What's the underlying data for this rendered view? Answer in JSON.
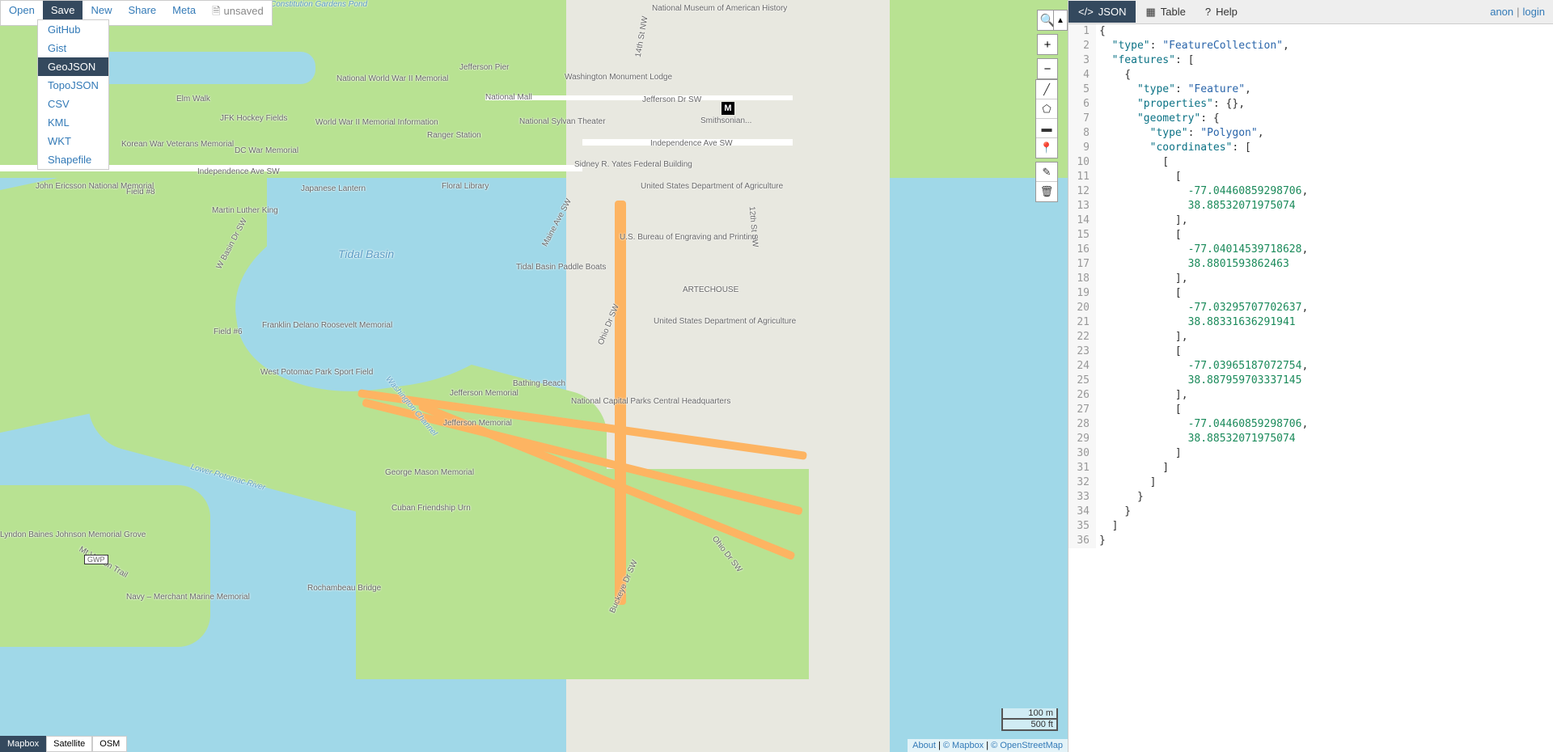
{
  "menu": {
    "open": "Open",
    "save": "Save",
    "new": "New",
    "share": "Share",
    "meta": "Meta",
    "status": "unsaved"
  },
  "dropdown": {
    "github": "GitHub",
    "gist": "Gist",
    "geojson": "GeoJSON",
    "topojson": "TopoJSON",
    "csv": "CSV",
    "kml": "KML",
    "wkt": "WKT",
    "shapefile": "Shapefile"
  },
  "tabs": {
    "json": "JSON",
    "table": "Table",
    "help": "Help"
  },
  "auth": {
    "anon": "anon",
    "login": "login"
  },
  "layers": {
    "mapbox": "Mapbox",
    "satellite": "Satellite",
    "osm": "OSM"
  },
  "scale": {
    "metric": "100 m",
    "imperial": "500 ft"
  },
  "attribution": {
    "about": "About",
    "mapbox": "© Mapbox",
    "osm": "© OpenStreetMap"
  },
  "zoom": {
    "plus": "+",
    "minus": "−",
    "search": "🔍"
  },
  "map_labels": {
    "nmah": "National Museum of\nAmerican History",
    "const_pond": "Constitution\nGardens Pond",
    "jefferson_pier": "Jefferson Pier",
    "washington_mon": "Washington\nMonument Lodge",
    "nww2": "National World\nWar II Memorial",
    "ww2info": "World War II Memorial\nInformation",
    "national_mall": "National Mall",
    "jeff_dr": "Jefferson Dr SW",
    "nat_sylvan": "National Sylvan\nTheater",
    "smithsonian": "Smithsonian...",
    "elm_walk": "Elm Walk",
    "jfk": "JFK Hockey Fields",
    "ranger": "Ranger Station",
    "ind_ave": "Independence Ave SW",
    "ind_ave2": "Independence Ave SW",
    "japanese": "Japanese Lantern",
    "floral": "Floral Library",
    "yates": "Sidney R. Yates\nFederal Building",
    "usda1": "United States Department\nof Agriculture",
    "usda2": "United States Department\nof Agriculture",
    "artechouse": "ARTECHOUSE",
    "bep": "U.S. Bureau of Engraving\nand Printing",
    "mlk": "Martin Luther King",
    "korean": "Korean War\nVeterans Memorial",
    "dcwar": "DC War Memorial",
    "field8": "Field #8",
    "field6": "Field #6",
    "ericsson": "John Ericsson\nNational Memorial",
    "tidal_basin": "Tidal Basin",
    "tidal_paddle": "Tidal Basin\nPaddle Boats",
    "fdr": "Franklin Delano\nRoosevelt Memorial",
    "west_potomac": "West Potomac\nPark Sport Field",
    "jeff_mem": "Jefferson Memorial",
    "jeff_mem2": "Jefferson Memorial",
    "bathing": "Bathing Beach",
    "ncp": "National Capital Parks\nCentral Headquarters",
    "wash_channel": "Washington Channel",
    "lower_potomac": "Lower Potomac River",
    "george_mason": "George Mason\nMemorial",
    "cuban": "Cuban Friendship Urn",
    "rochambeau": "Rochambeau Bridge",
    "navy": "Navy – Merchant\nMarine Memorial",
    "lbj": "Lyndon Baines Johnson\nMemorial Grove",
    "mt_vernon": "Mt Vernon Trail",
    "maine": "Maine Ave SW",
    "ohio1": "Ohio Dr SW",
    "ohio2": "Ohio Dr SW",
    "buckeye": "Buckeye Dr SW",
    "basin": "W Basin Dr SW",
    "14th": "14th St NW",
    "12th": "12th St SW",
    "gwp": "GWP"
  },
  "geojson": {
    "type": "FeatureCollection",
    "features": [
      {
        "type": "Feature",
        "properties": {},
        "geometry": {
          "type": "Polygon",
          "coordinates": [
            [
              [
                -77.04460859298706,
                38.88532071975074
              ],
              [
                -77.04014539718628,
                38.8801593862463
              ],
              [
                -77.03295707702637,
                38.88331636291941
              ],
              [
                -77.03965187072754,
                38.887959703337145
              ],
              [
                -77.04460859298706,
                38.88532071975074
              ]
            ]
          ]
        }
      }
    ]
  },
  "code_lines": [
    [
      {
        "t": "pun",
        "v": "{"
      }
    ],
    [
      {
        "t": "pun",
        "v": "  "
      },
      {
        "t": "key",
        "v": "\"type\""
      },
      {
        "t": "pun",
        "v": ": "
      },
      {
        "t": "str",
        "v": "\"FeatureCollection\""
      },
      {
        "t": "pun",
        "v": ","
      }
    ],
    [
      {
        "t": "pun",
        "v": "  "
      },
      {
        "t": "key",
        "v": "\"features\""
      },
      {
        "t": "pun",
        "v": ": ["
      }
    ],
    [
      {
        "t": "pun",
        "v": "    {"
      }
    ],
    [
      {
        "t": "pun",
        "v": "      "
      },
      {
        "t": "key",
        "v": "\"type\""
      },
      {
        "t": "pun",
        "v": ": "
      },
      {
        "t": "str",
        "v": "\"Feature\""
      },
      {
        "t": "pun",
        "v": ","
      }
    ],
    [
      {
        "t": "pun",
        "v": "      "
      },
      {
        "t": "key",
        "v": "\"properties\""
      },
      {
        "t": "pun",
        "v": ": {},"
      }
    ],
    [
      {
        "t": "pun",
        "v": "      "
      },
      {
        "t": "key",
        "v": "\"geometry\""
      },
      {
        "t": "pun",
        "v": ": {"
      }
    ],
    [
      {
        "t": "pun",
        "v": "        "
      },
      {
        "t": "key",
        "v": "\"type\""
      },
      {
        "t": "pun",
        "v": ": "
      },
      {
        "t": "str",
        "v": "\"Polygon\""
      },
      {
        "t": "pun",
        "v": ","
      }
    ],
    [
      {
        "t": "pun",
        "v": "        "
      },
      {
        "t": "key",
        "v": "\"coordinates\""
      },
      {
        "t": "pun",
        "v": ": ["
      }
    ],
    [
      {
        "t": "pun",
        "v": "          ["
      }
    ],
    [
      {
        "t": "pun",
        "v": "            ["
      }
    ],
    [
      {
        "t": "pun",
        "v": "              "
      },
      {
        "t": "num",
        "v": "-77.04460859298706"
      },
      {
        "t": "pun",
        "v": ","
      }
    ],
    [
      {
        "t": "pun",
        "v": "              "
      },
      {
        "t": "num",
        "v": "38.88532071975074"
      }
    ],
    [
      {
        "t": "pun",
        "v": "            ],"
      }
    ],
    [
      {
        "t": "pun",
        "v": "            ["
      }
    ],
    [
      {
        "t": "pun",
        "v": "              "
      },
      {
        "t": "num",
        "v": "-77.04014539718628"
      },
      {
        "t": "pun",
        "v": ","
      }
    ],
    [
      {
        "t": "pun",
        "v": "              "
      },
      {
        "t": "num",
        "v": "38.8801593862463"
      }
    ],
    [
      {
        "t": "pun",
        "v": "            ],"
      }
    ],
    [
      {
        "t": "pun",
        "v": "            ["
      }
    ],
    [
      {
        "t": "pun",
        "v": "              "
      },
      {
        "t": "num",
        "v": "-77.03295707702637"
      },
      {
        "t": "pun",
        "v": ","
      }
    ],
    [
      {
        "t": "pun",
        "v": "              "
      },
      {
        "t": "num",
        "v": "38.88331636291941"
      }
    ],
    [
      {
        "t": "pun",
        "v": "            ],"
      }
    ],
    [
      {
        "t": "pun",
        "v": "            ["
      }
    ],
    [
      {
        "t": "pun",
        "v": "              "
      },
      {
        "t": "num",
        "v": "-77.03965187072754"
      },
      {
        "t": "pun",
        "v": ","
      }
    ],
    [
      {
        "t": "pun",
        "v": "              "
      },
      {
        "t": "num",
        "v": "38.887959703337145"
      }
    ],
    [
      {
        "t": "pun",
        "v": "            ],"
      }
    ],
    [
      {
        "t": "pun",
        "v": "            ["
      }
    ],
    [
      {
        "t": "pun",
        "v": "              "
      },
      {
        "t": "num",
        "v": "-77.04460859298706"
      },
      {
        "t": "pun",
        "v": ","
      }
    ],
    [
      {
        "t": "pun",
        "v": "              "
      },
      {
        "t": "num",
        "v": "38.88532071975074"
      }
    ],
    [
      {
        "t": "pun",
        "v": "            ]"
      }
    ],
    [
      {
        "t": "pun",
        "v": "          ]"
      }
    ],
    [
      {
        "t": "pun",
        "v": "        ]"
      }
    ],
    [
      {
        "t": "pun",
        "v": "      }"
      }
    ],
    [
      {
        "t": "pun",
        "v": "    }"
      }
    ],
    [
      {
        "t": "pun",
        "v": "  ]"
      }
    ],
    [
      {
        "t": "pun",
        "v": "}"
      }
    ]
  ]
}
